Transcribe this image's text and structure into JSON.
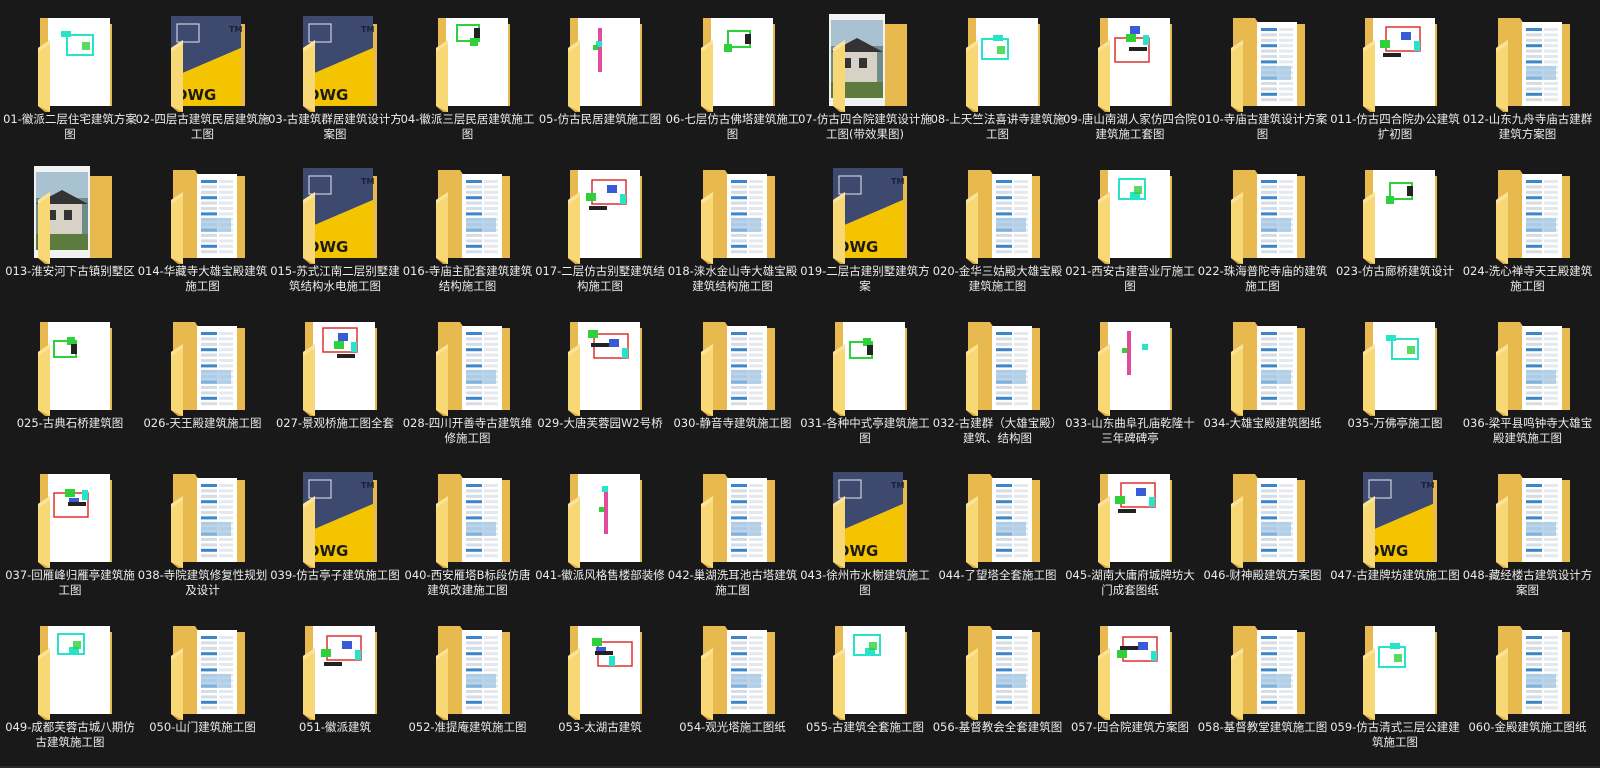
{
  "window": {
    "background": "#191919"
  },
  "colors": {
    "folder_back": "#e8b94e",
    "folder_front": "#f8d775",
    "folder_front_light": "#fbe39a",
    "paper": "#ffffff",
    "dwg_yellow": "#f5c400",
    "dwg_navy": "#2d3a63",
    "cad_cyan": "#27e4c9",
    "cad_green": "#2fd13a",
    "list_blue": "#3a86c8",
    "label_text": "#ececec"
  },
  "files": [
    {
      "name": "01-徽派二层住宅建筑方案图",
      "thumb": "cad-cyan"
    },
    {
      "name": "02-四层古建筑民居建筑施工图",
      "thumb": "dwg"
    },
    {
      "name": "03-古建筑群居建筑设计方案图",
      "thumb": "dwg"
    },
    {
      "name": "04-徽派三层民居建筑施工图",
      "thumb": "cad-green"
    },
    {
      "name": "05-仿古民居建筑施工图",
      "thumb": "cad-sparse"
    },
    {
      "name": "06-七层仿古佛塔建筑施工图",
      "thumb": "cad-green"
    },
    {
      "name": "07-仿古四合院建筑设计施工图(带效果图)",
      "thumb": "photo"
    },
    {
      "name": "08-上天竺法喜讲寺建筑施工图",
      "thumb": "cad-cyan"
    },
    {
      "name": "09-唐山南湖人家仿四合院建筑施工套图",
      "thumb": "cad-mixed"
    },
    {
      "name": "010-寺庙古建筑设计方案图",
      "thumb": "list"
    },
    {
      "name": "011-仿古四合院办公建筑扩初图",
      "thumb": "cad-mixed"
    },
    {
      "name": "012-山东九舟寺庙古建群建筑方案图",
      "thumb": "list"
    },
    {
      "name": "013-淮安河下古镇别墅区",
      "thumb": "photo"
    },
    {
      "name": "014-华藏寺大雄宝殿建筑施工图",
      "thumb": "list"
    },
    {
      "name": "015-苏式江南二层别墅建筑结构水电施工图",
      "thumb": "dwg"
    },
    {
      "name": "016-寺庙主配套建筑建筑结构施工图",
      "thumb": "list"
    },
    {
      "name": "017-二层仿古别墅建筑结构施工图",
      "thumb": "cad-mixed"
    },
    {
      "name": "018-涞水金山寺大雄宝殿建筑结构施工图",
      "thumb": "list"
    },
    {
      "name": "019-二层古建别墅建筑方案",
      "thumb": "dwg"
    },
    {
      "name": "020-金华三姑殿大雄宝殿建筑施工图",
      "thumb": "list"
    },
    {
      "name": "021-西安古建营业厅施工图",
      "thumb": "cad-cyan"
    },
    {
      "name": "022-珠海普陀寺庙的建筑施工图",
      "thumb": "list"
    },
    {
      "name": "023-仿古廊桥建筑设计",
      "thumb": "cad-green"
    },
    {
      "name": "024-洗心禅寺天王殿建筑施工图",
      "thumb": "list"
    },
    {
      "name": "025-古典石桥建筑图",
      "thumb": "cad-green"
    },
    {
      "name": "026-天王殿建筑施工图",
      "thumb": "list"
    },
    {
      "name": "027-景观桥施工图全套",
      "thumb": "cad-mixed"
    },
    {
      "name": "028-四川开善寺古建筑维修施工图",
      "thumb": "list"
    },
    {
      "name": "029-大唐芙蓉园W2号桥",
      "thumb": "cad-mixed"
    },
    {
      "name": "030-静音寺建筑施工图",
      "thumb": "list"
    },
    {
      "name": "031-各种中式亭建筑施工图",
      "thumb": "cad-green"
    },
    {
      "name": "032-古建群（大雄宝殿）建筑、结构图",
      "thumb": "list"
    },
    {
      "name": "033-山东曲阜孔庙乾隆十三年碑碑亭",
      "thumb": "cad-sparse"
    },
    {
      "name": "034-大雄宝殿建筑图纸",
      "thumb": "list"
    },
    {
      "name": "035-万佛亭施工图",
      "thumb": "cad-cyan"
    },
    {
      "name": "036-梁平县鸣钟寺大雄宝殿建筑施工图",
      "thumb": "list"
    },
    {
      "name": "037-回雁峰归雁亭建筑施工图",
      "thumb": "cad-mixed"
    },
    {
      "name": "038-寺院建筑修复性规划及设计",
      "thumb": "list"
    },
    {
      "name": "039-仿古亭子建筑施工图",
      "thumb": "dwg"
    },
    {
      "name": "040-西安雁塔B标段仿唐建筑改建施工图",
      "thumb": "list"
    },
    {
      "name": "041-徽派风格售楼部装修",
      "thumb": "cad-sparse"
    },
    {
      "name": "042-巢湖洗耳池古塔建筑施工图",
      "thumb": "list"
    },
    {
      "name": "043-徐州市水榭建筑施工图",
      "thumb": "dwg"
    },
    {
      "name": "044-了望塔全套施工图",
      "thumb": "list"
    },
    {
      "name": "045-湖南大庸府城牌坊大门成套图纸",
      "thumb": "cad-mixed"
    },
    {
      "name": "046-财神殿建筑方案图",
      "thumb": "list"
    },
    {
      "name": "047-古建牌坊建筑施工图",
      "thumb": "dwg"
    },
    {
      "name": "048-藏经楼古建筑设计方案图",
      "thumb": "list"
    },
    {
      "name": "049-成都芙蓉古城八期仿古建筑施工图",
      "thumb": "cad-cyan"
    },
    {
      "name": "050-山门建筑施工图",
      "thumb": "list"
    },
    {
      "name": "051-徽派建筑",
      "thumb": "cad-mixed"
    },
    {
      "name": "052-准提庵建筑施工图",
      "thumb": "list"
    },
    {
      "name": "053-太湖古建筑",
      "thumb": "cad-mixed"
    },
    {
      "name": "054-观光塔施工图纸",
      "thumb": "list"
    },
    {
      "name": "055-古建筑全套施工图",
      "thumb": "cad-cyan"
    },
    {
      "name": "056-基督教会全套建筑图",
      "thumb": "list"
    },
    {
      "name": "057-四合院建筑方案图",
      "thumb": "cad-mixed"
    },
    {
      "name": "058-基督教堂建筑施工图",
      "thumb": "list"
    },
    {
      "name": "059-仿古清式三层公建建筑施工图",
      "thumb": "cad-cyan"
    },
    {
      "name": "060-金殿建筑施工图纸",
      "thumb": "list"
    }
  ]
}
